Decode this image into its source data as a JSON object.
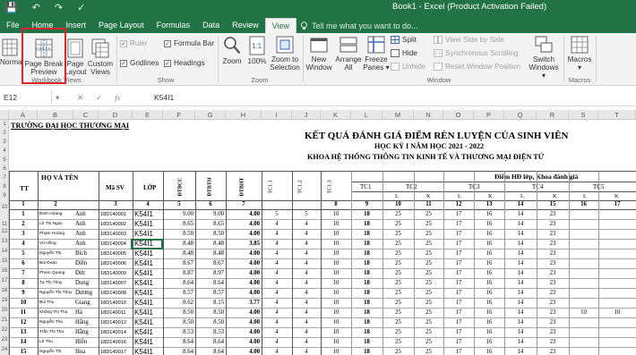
{
  "window": {
    "title": "Book1 - Excel (Product Activation Failed)",
    "quick_access": [
      "💾",
      "↶",
      "↷",
      "✓"
    ]
  },
  "tabs": [
    {
      "label": "File"
    },
    {
      "label": "Home"
    },
    {
      "label": "Insert"
    },
    {
      "label": "Page Layout"
    },
    {
      "label": "Formulas"
    },
    {
      "label": "Data"
    },
    {
      "label": "Review"
    },
    {
      "label": "View",
      "active": true
    }
  ],
  "tell_me": "Tell me what you want to do...",
  "ribbon": {
    "workbook_views": {
      "group_label": "Workbook Views",
      "normal": "Norma",
      "page_break_preview": [
        "Page Break",
        "Preview"
      ],
      "page_layout": [
        "Page",
        "Layout"
      ],
      "custom_views": [
        "Custom",
        "Views"
      ]
    },
    "show": {
      "group_label": "Show",
      "ruler": "Ruler",
      "formula_bar": "Formula Bar",
      "gridlines": "Gridlines",
      "headings": "Headings"
    },
    "zoom": {
      "group_label": "Zoom",
      "zoom": "Zoom",
      "hundred": "100%",
      "zoom_selection": [
        "Zoom to",
        "Selection"
      ]
    },
    "window": {
      "group_label": "Window",
      "new_window": [
        "New",
        "Window"
      ],
      "arrange_all": [
        "Arrange",
        "All"
      ],
      "freeze_panes": [
        "Freeze",
        "Panes ▾"
      ],
      "split": "Split",
      "hide": "Hide",
      "unhide": "Unhide",
      "view_side": "View Side by Side",
      "sync_scroll": "Synchronous Scrolling",
      "reset_pos": "Reset Window Position",
      "switch_windows": [
        "Switch",
        "Windows ▾"
      ]
    },
    "macros": {
      "group_label": "Macros",
      "macros": [
        "Macros",
        "▾"
      ]
    }
  },
  "formula_bar": {
    "name_box": "E12",
    "cancel": "✕",
    "enter": "✓",
    "fx": "fx",
    "value": "K54I1"
  },
  "columns": [
    "A",
    "B",
    "C",
    "D",
    "E",
    "F",
    "G",
    "H",
    "I",
    "J",
    "K",
    "L",
    "M",
    "N",
    "O",
    "P",
    "Q",
    "R",
    "S",
    "T"
  ],
  "row_numbers": [
    "1",
    "2",
    "3",
    "4",
    "5",
    "6",
    "7",
    "8",
    "9",
    "10",
    "11",
    "12",
    "13",
    "14",
    "15",
    "16",
    "17",
    "18",
    "19",
    "20",
    "21",
    "22",
    "23",
    "24",
    "25",
    "26"
  ],
  "sheet": {
    "school": "TRƯỜNG ĐẠI HỌC THƯƠNG MẠI",
    "title1": "KẾT QUẢ ĐÁNH GIÁ ĐIỂM RÈN LUYỆN CỦA SINH VIÊN",
    "title2": "HỌC KỲ I NĂM HỌC 2021 - 2022",
    "title3": "KHOA HỆ THỐNG THÔNG TIN KINH TẾ VÀ THƯƠNG MẠI ĐIỆN TỬ",
    "eval_header": "Điểm HĐ lớp, Khoa đánh giá",
    "h_tt": "TT",
    "h_hoten": "HỌ VÀ TÊN",
    "h_masv": "Mã SV",
    "h_lop": "LỚP",
    "h_dtbcc": "ĐTBCC",
    "h_dtbth": "ĐTBTH",
    "h_dtbht": "ĐTBHT",
    "h_tc11": "TC1.1",
    "h_tc12": "TC1.2",
    "h_tc13": "TC1.3",
    "h_tc": [
      "TC1",
      "TC2",
      "TC3",
      "TC4",
      "TC5"
    ],
    "h_lk": [
      "L",
      "K",
      "L",
      "K",
      "L",
      "K",
      "L",
      "K"
    ],
    "colnums": [
      "1",
      "2",
      "3",
      "4",
      "5",
      "6",
      "7",
      "8",
      "9",
      "10",
      "11",
      "12",
      "13",
      "14",
      "15",
      "16",
      "17"
    ],
    "rows": [
      [
        "1",
        "Đinh Hoàng",
        "Anh",
        "18D140001",
        "K54I1",
        "9.00",
        "9.00",
        "4.00",
        "5",
        "5",
        "10",
        "18",
        "25",
        "25",
        "17",
        "16",
        "14",
        "23",
        "",
        ""
      ],
      [
        "2",
        "Lê Thị Ngọc",
        "Anh",
        "18D140002",
        "K54I1",
        "8.65",
        "8.65",
        "4.00",
        "4",
        "4",
        "10",
        "18",
        "25",
        "25",
        "17",
        "16",
        "14",
        "23",
        "",
        ""
      ],
      [
        "3",
        "Phạm Hoàng",
        "Anh",
        "18D140003",
        "K54I1",
        "8.50",
        "8.50",
        "4.00",
        "4",
        "4",
        "10",
        "18",
        "25",
        "25",
        "17",
        "16",
        "14",
        "23",
        "",
        ""
      ],
      [
        "4",
        "Vũ Hồng",
        "Anh",
        "18D140004",
        "K54I1",
        "8.48",
        "8.48",
        "3.85",
        "4",
        "4",
        "10",
        "18",
        "25",
        "25",
        "17",
        "16",
        "14",
        "23",
        "",
        ""
      ],
      [
        "5",
        "Nguyễn Thị",
        "Bích",
        "18D140005",
        "K54I1",
        "8.48",
        "8.48",
        "4.00",
        "4",
        "4",
        "10",
        "18",
        "25",
        "25",
        "17",
        "16",
        "14",
        "23",
        "",
        ""
      ],
      [
        "6",
        "Bùi Đoàn",
        "Điền",
        "18D140006",
        "K54I1",
        "8.67",
        "8.67",
        "4.00",
        "4",
        "4",
        "10",
        "18",
        "25",
        "25",
        "17",
        "16",
        "14",
        "23",
        "",
        ""
      ],
      [
        "7",
        "Phùm Quang",
        "Đức",
        "18D140009",
        "K54I1",
        "8.87",
        "8.97",
        "4.00",
        "4",
        "4",
        "10",
        "18",
        "25",
        "25",
        "17",
        "16",
        "14",
        "23",
        "",
        ""
      ],
      [
        "8",
        "Tạ Thị Thúy",
        "Dung",
        "18D140007",
        "K54I1",
        "8.64",
        "8.64",
        "4.00",
        "4",
        "4",
        "10",
        "18",
        "25",
        "25",
        "17",
        "16",
        "14",
        "23",
        "",
        ""
      ],
      [
        "9",
        "Nguyễn Thị Thùy",
        "Dương",
        "18D140008",
        "K54I1",
        "8.57",
        "8.57",
        "4.00",
        "4",
        "4",
        "10",
        "18",
        "25",
        "25",
        "17",
        "16",
        "14",
        "23",
        "",
        ""
      ],
      [
        "10",
        "Bùi Thu",
        "Giang",
        "18D140010",
        "K54I1",
        "8.62",
        "8.15",
        "3.77",
        "4",
        "4",
        "10",
        "18",
        "25",
        "25",
        "17",
        "16",
        "14",
        "23",
        "",
        ""
      ],
      [
        "11",
        "Khổng Thị Thu",
        "Hà",
        "18D140011",
        "K54I1",
        "8.50",
        "8.50",
        "4.00",
        "4",
        "4",
        "10",
        "18",
        "25",
        "25",
        "17",
        "16",
        "14",
        "23",
        "10",
        "10"
      ],
      [
        "12",
        "Nguyễn Thu",
        "Hằng",
        "18D140012",
        "K54I1",
        "8.50",
        "8.50",
        "4.00",
        "4",
        "4",
        "10",
        "18",
        "25",
        "25",
        "17",
        "16",
        "14",
        "23",
        "",
        ""
      ],
      [
        "13",
        "Trần Thị Thu",
        "Hằng",
        "18D140014",
        "K54I1",
        "8.53",
        "8.53",
        "4.00",
        "4",
        "4",
        "10",
        "18",
        "25",
        "25",
        "17",
        "16",
        "14",
        "23",
        "",
        ""
      ],
      [
        "14",
        "Lê Thu",
        "Hiền",
        "18D140016",
        "K54I1",
        "8.64",
        "8.64",
        "4.00",
        "4",
        "4",
        "10",
        "18",
        "25",
        "25",
        "17",
        "16",
        "14",
        "23",
        "",
        ""
      ],
      [
        "15",
        "Nguyễn Thị",
        "Hoa",
        "18D140017",
        "K54I1",
        "8.64",
        "8.64",
        "4.00",
        "4",
        "4",
        "10",
        "18",
        "25",
        "25",
        "17",
        "16",
        "14",
        "23",
        "",
        ""
      ],
      [
        "16",
        "Nguyễn Lê",
        "Hoàng",
        "18D140018",
        "K54I1",
        "8.88",
        "8.88",
        "3.63",
        "4",
        "4",
        "10",
        "18",
        "25",
        "25",
        "17",
        "16",
        "14",
        "23",
        "",
        ""
      ]
    ]
  }
}
